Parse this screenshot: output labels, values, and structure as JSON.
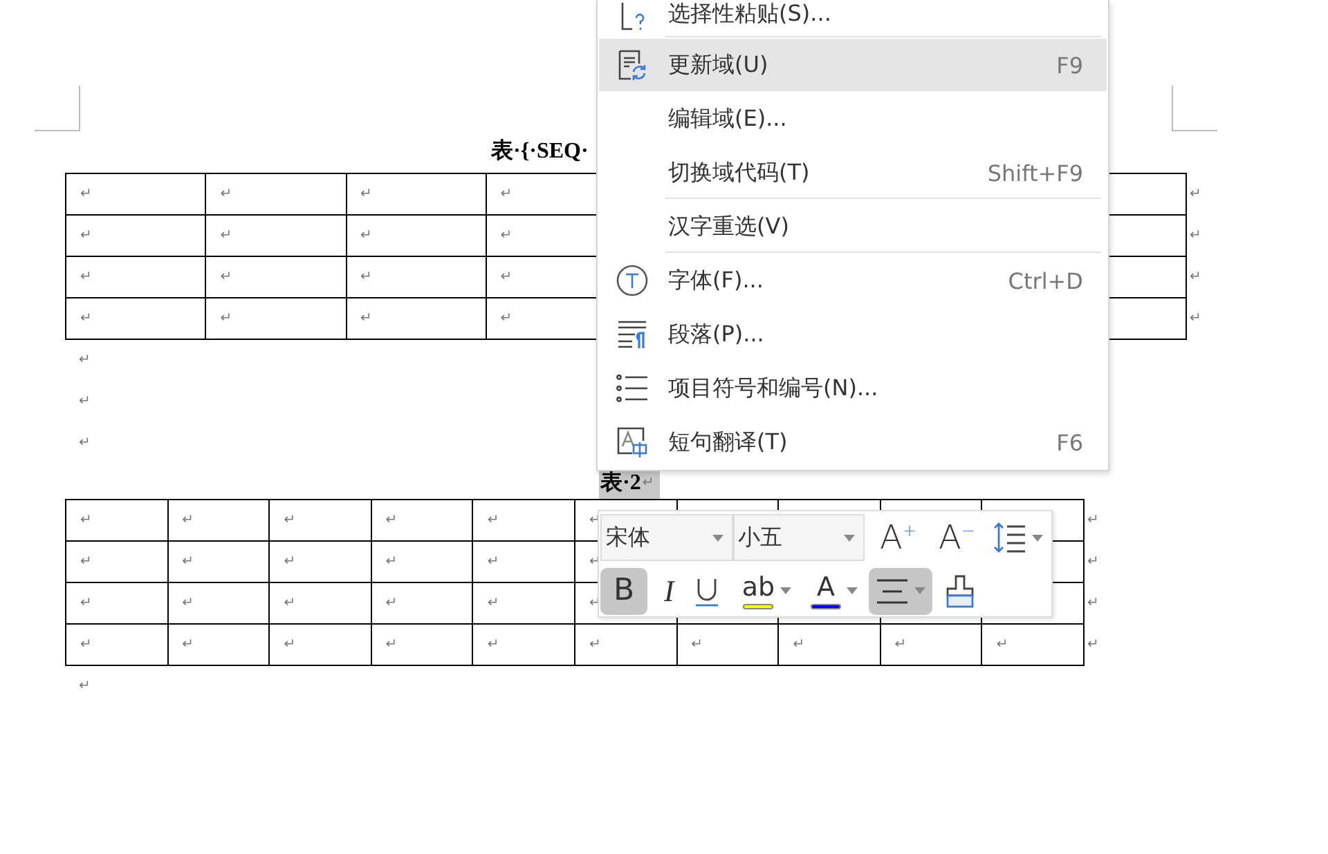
{
  "document": {
    "caption_1": "表·{·SEQ·",
    "table_1": {
      "rows": [
        {
          "cells": [
            "↵",
            "↵",
            "↵",
            "↵"
          ],
          "end_mark": "↵"
        },
        {
          "cells": [
            "↵",
            "↵",
            "↵",
            "↵"
          ],
          "end_mark": "↵"
        },
        {
          "cells": [
            "↵",
            "↵",
            "↵",
            "↵"
          ],
          "end_mark": "↵"
        },
        {
          "cells": [
            "↵",
            "↵",
            "↵",
            "↵"
          ],
          "end_mark": "↵"
        }
      ]
    },
    "paragraph_marks": [
      "↵",
      "↵",
      "↵"
    ],
    "caption_2": {
      "text": "表·2",
      "mark": "↵",
      "selected": true
    },
    "table_2": {
      "rows": [
        {
          "cells": [
            "↵",
            "↵",
            "↵",
            "↵",
            "↵",
            "↵"
          ],
          "end_mark": "↵"
        },
        {
          "cells": [
            "↵",
            "↵",
            "↵",
            "↵",
            "↵",
            "↵"
          ],
          "end_mark": "↵"
        },
        {
          "cells": [
            "↵",
            "↵",
            "↵",
            "↵",
            "↵",
            "↵"
          ],
          "end_mark": "↵"
        },
        {
          "cells": [
            "↵",
            "↵",
            "↵",
            "↵",
            "↵",
            "↵",
            "↵",
            "↵",
            "↵",
            "↵"
          ],
          "end_mark": "↵"
        }
      ]
    },
    "final_mark": "↵"
  },
  "context_menu": {
    "items": [
      {
        "label": "选择性粘贴(S)...",
        "selected": false,
        "divider_below": true
      },
      {
        "label": "更新域(U)",
        "shortcut": "F9",
        "selected": true,
        "divider_below": false
      },
      {
        "label": "编辑域(E)...",
        "selected": false,
        "divider_below": false
      },
      {
        "label": "切换域代码(T)",
        "shortcut": "Shift+F9",
        "selected": false,
        "divider_below": true
      },
      {
        "label": "汉字重选(V)",
        "selected": false,
        "divider_below": true
      },
      {
        "label": "字体(F)...",
        "shortcut": "Ctrl+D",
        "selected": false,
        "divider_below": false
      },
      {
        "label": "段落(P)...",
        "selected": false,
        "divider_below": false
      },
      {
        "label": "项目符号和编号(N)...",
        "selected": false,
        "divider_below": false
      },
      {
        "label": "短句翻译(T)",
        "shortcut": "F6",
        "selected": false,
        "divider_below": false
      }
    ]
  },
  "mini_toolbar": {
    "font_name": "宋体",
    "font_size": "小五",
    "row_1": [
      {
        "kind": "grow",
        "label": "A$^{+}$",
        "active": false
      },
      {
        "kind": "shrink",
        "label": "A$^{−}$",
        "active": false
      },
      {
        "kind": "line_spacing",
        "active": false
      }
    ],
    "row_2": [
      {
        "kind": "bold",
        "label": "B",
        "active": true
      },
      {
        "kind": "italic",
        "label": "I",
        "active": false
      },
      {
        "kind": "underline",
        "active": false
      },
      {
        "kind": "highlight",
        "label": "ab",
        "color": "#ffff00",
        "active": false
      },
      {
        "kind": "font_color",
        "label": "A",
        "color": "#0000ff",
        "active": false
      },
      {
        "kind": "align",
        "active": true
      },
      {
        "kind": "painter",
        "active": false
      }
    ]
  }
}
